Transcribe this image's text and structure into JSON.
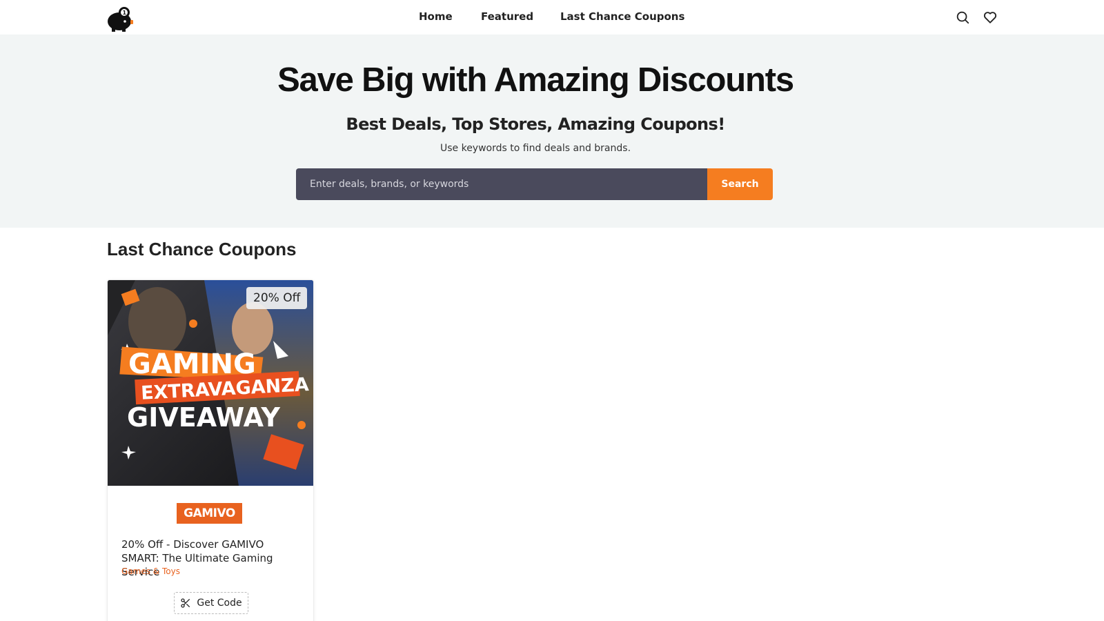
{
  "header": {
    "logo_icon": "piggy-bank-icon",
    "nav": [
      {
        "label": "Home"
      },
      {
        "label": "Featured"
      },
      {
        "label": "Last Chance Coupons"
      }
    ],
    "icons": [
      "search-icon",
      "heart-icon"
    ]
  },
  "hero": {
    "title": "Save Big with Amazing Discounts",
    "subtitle": "Best Deals, Top Stores, Amazing Coupons!",
    "hint": "Use keywords to find deals and brands.",
    "search_placeholder": "Enter deals, brands, or keywords",
    "search_button": "Search"
  },
  "section": {
    "title": "Last Chance Coupons"
  },
  "coupons": [
    {
      "image_text": [
        "GAMING",
        "EXTRAVAGANZA",
        "GIVEAWAY"
      ],
      "discount": "20% Off",
      "brand": "GAMIVO",
      "title": "20% Off - Discover GAMIVO SMART: The Ultimate Gaming Service",
      "category": "Games & Toys",
      "action_label": "Get Code",
      "action_icon": "scissors-icon"
    }
  ],
  "colors": {
    "accent": "#f57d20",
    "brand_orange": "#e8621f",
    "search_bg": "#4a4a5c",
    "hero_bg": "#f2f5f5"
  }
}
